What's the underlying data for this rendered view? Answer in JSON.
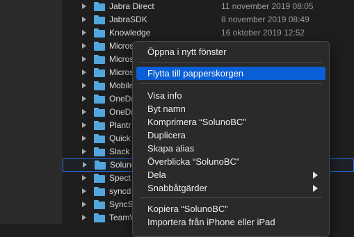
{
  "files": [
    {
      "name": "Jabra Direct",
      "date": "11 november 2019 08:05"
    },
    {
      "name": "JabraSDK",
      "date": "8 november 2019 08:49"
    },
    {
      "name": "Knowledge",
      "date": "16 oktober 2019 12:52"
    },
    {
      "name": "Micros",
      "date": ""
    },
    {
      "name": "Micros",
      "date": ""
    },
    {
      "name": "Micros",
      "date": ""
    },
    {
      "name": "Mobile",
      "date": ""
    },
    {
      "name": "OneDr",
      "date": ""
    },
    {
      "name": "OneDr",
      "date": ""
    },
    {
      "name": "Plantr",
      "date": ""
    },
    {
      "name": "Quick",
      "date": ""
    },
    {
      "name": "Slack",
      "date": ""
    },
    {
      "name": "Soluno",
      "date": ""
    },
    {
      "name": "Spect",
      "date": ""
    },
    {
      "name": "syncd",
      "date": ""
    },
    {
      "name": "SyncS",
      "date": ""
    },
    {
      "name": "TeamV",
      "date": ""
    }
  ],
  "context_menu": {
    "open_new_window": "Öppna i nytt fönster",
    "move_to_trash": "Flytta till papperskorgen",
    "get_info": "Visa info",
    "rename": "Byt namn",
    "compress": "Komprimera “SolunoBC”",
    "duplicate": "Duplicera",
    "make_alias": "Skapa alias",
    "quick_look": "Överblicka “SolunoBC”",
    "share": "Dela",
    "quick_actions": "Snabbåtgärder",
    "copy": "Kopiera “SolunoBC”",
    "import_iphone": "Importera från iPhone eller iPad"
  },
  "colors": {
    "highlight": "#0a5fd6",
    "folder": "#52a6de",
    "selection_outline": "#2b6fd8"
  }
}
